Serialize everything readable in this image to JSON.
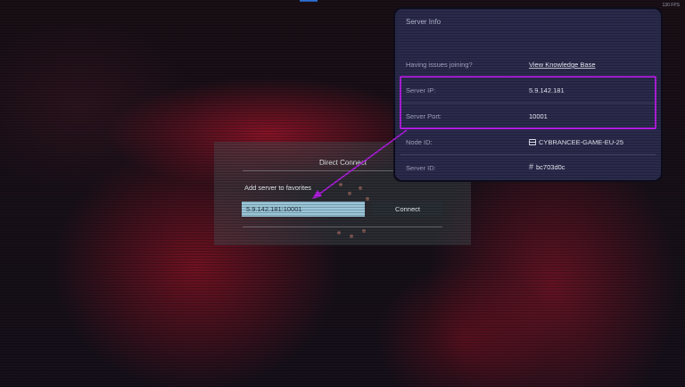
{
  "top_bar": {
    "fps_label": "130 FPS"
  },
  "direct_connect": {
    "title": "Direct Connect",
    "add_favorites_label": "Add server to favorites",
    "address_value": "5.9.142.181:10001",
    "connect_label": "Connect"
  },
  "server_info": {
    "title": "Server Info",
    "rows": [
      {
        "label": "Having issues joining?",
        "value": "View Knowledge Base"
      },
      {
        "label": "Server IP:",
        "value": "5.9.142.181"
      },
      {
        "label": "Server Port:",
        "value": "10001"
      },
      {
        "label": "Node ID:",
        "value": "CYBRANCEE-GAME-EU-25",
        "icon": "server-icon"
      },
      {
        "label": "Server ID:",
        "value": "bc703d0c",
        "icon": "hash-icon"
      }
    ]
  },
  "colors": {
    "highlight": "#b01ee0",
    "panel": "#2a2a4c",
    "input": "#9ac6d8"
  }
}
